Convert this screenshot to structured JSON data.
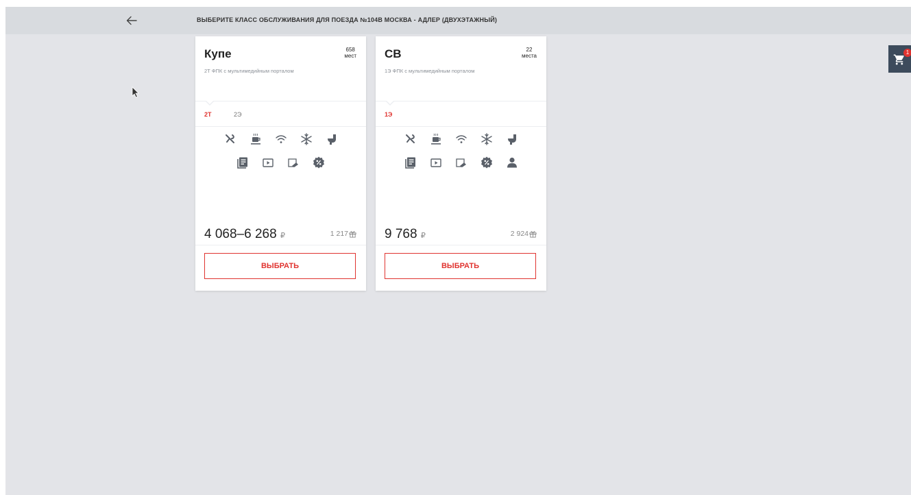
{
  "header": {
    "title": "ВЫБЕРИТЕ КЛАСС ОБСЛУЖИВАНИЯ ДЛЯ ПОЕЗДА №104В МОСКВА - АДЛЕР (ДВУХЭТАЖНЫЙ)"
  },
  "cart": {
    "badge": "1"
  },
  "colors": {
    "accent": "#e0332f",
    "icon": "#5a6069",
    "topbar": "#d8dbdf",
    "background": "#e3e4e8"
  },
  "cards": [
    {
      "title": "Купе",
      "seats_count": "658",
      "seats_word": "мест",
      "subtitle": "2Т ФПК с мультимедийным порталом",
      "tabs": [
        {
          "label": "2Т",
          "active": true
        },
        {
          "label": "2Э",
          "active": false
        }
      ],
      "amenities_row1": [
        "restaurant-icon",
        "coffee-icon",
        "wifi-icon",
        "snowflake-icon",
        "toilet-icon"
      ],
      "amenities_row2": [
        "newspaper-icon",
        "video-icon",
        "hygiene-kit-icon",
        "discount-icon"
      ],
      "price": "4 068–6 268",
      "currency": "₽",
      "bonus": "1 217",
      "button_label": "ВЫБРАТЬ"
    },
    {
      "title": "СВ",
      "seats_count": "22",
      "seats_word": "места",
      "subtitle": "1Э ФПК с мультимедийным порталом",
      "tabs": [
        {
          "label": "1Э",
          "active": true
        }
      ],
      "amenities_row1": [
        "restaurant-icon",
        "coffee-icon",
        "wifi-icon",
        "snowflake-icon",
        "toilet-icon"
      ],
      "amenities_row2": [
        "newspaper-icon",
        "video-icon",
        "hygiene-kit-icon",
        "discount-icon",
        "person-icon"
      ],
      "price": "9 768",
      "currency": "₽",
      "bonus": "2 924",
      "button_label": "ВЫБРАТЬ"
    }
  ]
}
